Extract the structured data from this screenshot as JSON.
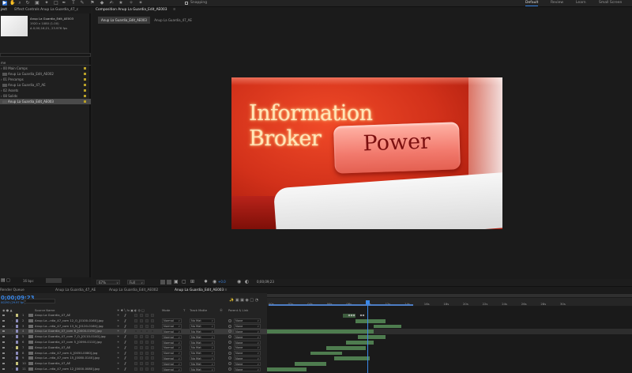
{
  "toolbar": {
    "snapping_label": "Snapping",
    "workspaces": [
      "Default",
      "Review",
      "Learn",
      "Small Screen"
    ],
    "active_workspace": "Default"
  },
  "project_panel": {
    "tab_project": "ject",
    "tab_effect_controls": "Effect Controls Anup La Guardia_47_c",
    "comp_name": "Anup La Guardia_Edit_AE003",
    "comp_info_1": "1920 x 1080 (1.00)",
    "comp_info_2": "Δ 0;00;16;21, 23.976 fps",
    "list_header": "me",
    "items": [
      {
        "label": "00 Main Comps",
        "indent": 0,
        "selected": false,
        "swatch": true
      },
      {
        "label": "Anup La Guardia_Edit_AE002",
        "indent": 1,
        "selected": false,
        "swatch": true
      },
      {
        "label": "01 Precomps",
        "indent": 0,
        "selected": false,
        "swatch": true
      },
      {
        "label": "Anup La Guardia_47_AE",
        "indent": 1,
        "selected": false,
        "swatch": true
      },
      {
        "label": "02 Assets",
        "indent": 0,
        "selected": false,
        "swatch": true
      },
      {
        "label": "08 Solids",
        "indent": 0,
        "selected": false,
        "swatch": true
      },
      {
        "label": "Anup La Guardia_Edit_AE003",
        "indent": 1,
        "selected": true,
        "swatch": true
      }
    ],
    "bpc_label": "16 bpc"
  },
  "composition_panel": {
    "header": "Composition Anup La Guardia_Edit_AE003",
    "tabs": [
      "Anup La Guardia_Edit_AE003",
      "Anup La Guardia_47_AE"
    ],
    "active_tab": "Anup La Guardia_Edit_AE003",
    "frame_text_line1": "Information",
    "frame_text_line2": "Broker",
    "frame_button_text": "Power",
    "zoom": "67%",
    "resolution": "Full",
    "exposure": "+0.0",
    "timecode": "0;00;09;23"
  },
  "timeline": {
    "tabs": [
      {
        "label": "Render Queue",
        "selected": false
      },
      {
        "label": "Anup La Guardia_47_AE",
        "selected": false
      },
      {
        "label": "Anup La Guardia_Edit_AE002",
        "selected": false
      },
      {
        "label": "Anup La Guardia_Edit_AE003",
        "selected": true
      }
    ],
    "current_time": "0;00;09;23",
    "fps_label": "00293 (29.97 fps)",
    "column_headers": {
      "source_name": "Source Name",
      "mode": "Mode",
      "t": "T",
      "track_matte": "Track Matte",
      "parent": "Parent & Link"
    },
    "ruler_ticks": [
      "00s",
      "02s",
      "04s",
      "06s",
      "08s",
      "10s",
      "12s",
      "14s",
      "16s",
      "18s",
      "20s",
      "22s",
      "24s",
      "26s",
      "28s",
      "30s"
    ],
    "layers": [
      {
        "num": "1",
        "name": "Anup La Guardia_47_AE",
        "mode": "",
        "matte": "",
        "parent": "",
        "label_color": "#c6c27a",
        "selected": false
      },
      {
        "num": "2",
        "name": "Anup La...rdia_47_com 12_O_[0100-0160].jpg",
        "mode": "Normal",
        "matte": "No Mat",
        "parent": "None",
        "label_color": "#8a8ab8",
        "selected": false
      },
      {
        "num": "3",
        "name": "Anup La...rdia_47_com 13_N_[0120-0160].jpg",
        "mode": "Normal",
        "matte": "No Mat",
        "parent": "None",
        "label_color": "#8a8ab8",
        "selected": false
      },
      {
        "num": "4",
        "name": "Anup La Guardia_47_com 6_[0000-0190].jpg",
        "mode": "Normal",
        "matte": "No Mat",
        "parent": "None",
        "label_color": "#8a8ab8",
        "selected": true
      },
      {
        "num": "5",
        "name": "Anup La Guardia_47_com 7_O_[0110-0140].jpg",
        "mode": "Normal",
        "matte": "No Mat",
        "parent": "None",
        "label_color": "#8a8ab8",
        "selected": false
      },
      {
        "num": "6",
        "name": "Anup La Guardia_47_com 5_[0090-0110].jpg",
        "mode": "Normal",
        "matte": "No Mat",
        "parent": "None",
        "label_color": "#8a8ab8",
        "selected": false
      },
      {
        "num": "7",
        "name": "Anup La Guardia_47_AE",
        "mode": "Normal",
        "matte": "No Mat",
        "parent": "None",
        "label_color": "#c6c27a",
        "selected": false
      },
      {
        "num": "8",
        "name": "Anup La...rdia_47_com 4_[0050-0080].jpg",
        "mode": "Normal",
        "matte": "No Mat",
        "parent": "None",
        "label_color": "#8a8ab8",
        "selected": false
      },
      {
        "num": "9",
        "name": "Anup La...rdia_47_com 15_[0080-0140].jpg",
        "mode": "Normal",
        "matte": "No Mat",
        "parent": "None",
        "label_color": "#8a8ab8",
        "selected": false
      },
      {
        "num": "10",
        "name": "Anup La Guardia_47_AE",
        "mode": "Normal",
        "matte": "No Mat",
        "parent": "None",
        "label_color": "#c6c27a",
        "selected": false
      },
      {
        "num": "11",
        "name": "Anup La...rdia_47_com 12_[0000-0080].jpg",
        "mode": "Normal",
        "matte": "No Mat",
        "parent": "None",
        "label_color": "#8a8ab8",
        "selected": false
      }
    ]
  }
}
